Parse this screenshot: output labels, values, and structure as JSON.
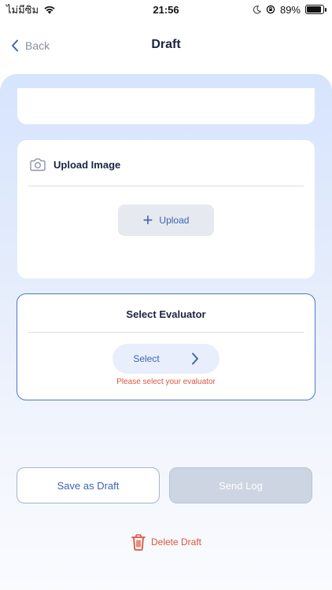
{
  "status_bar": {
    "carrier": "ไม่มีซิม",
    "time": "21:56",
    "battery_percent": "89%",
    "battery_level": 0.89,
    "icons": [
      "wifi-icon",
      "moon-icon",
      "orientation-lock-icon",
      "battery-icon"
    ]
  },
  "header": {
    "back_label": "Back",
    "title": "Draft"
  },
  "upload_card": {
    "title": "Upload Image",
    "button_label": "Upload",
    "icon": "camera-icon"
  },
  "evaluator_card": {
    "title": "Select Evaluator",
    "select_label": "Select",
    "error": "Please select your evaluator"
  },
  "actions": {
    "save_draft": "Save as Draft",
    "send_log": "Send Log",
    "delete_draft": "Delete Draft"
  },
  "colors": {
    "accent": "#3b64b8",
    "danger": "#e0533d",
    "panel_top": "#d6e4fd",
    "disabled": "#cdd5e2"
  }
}
